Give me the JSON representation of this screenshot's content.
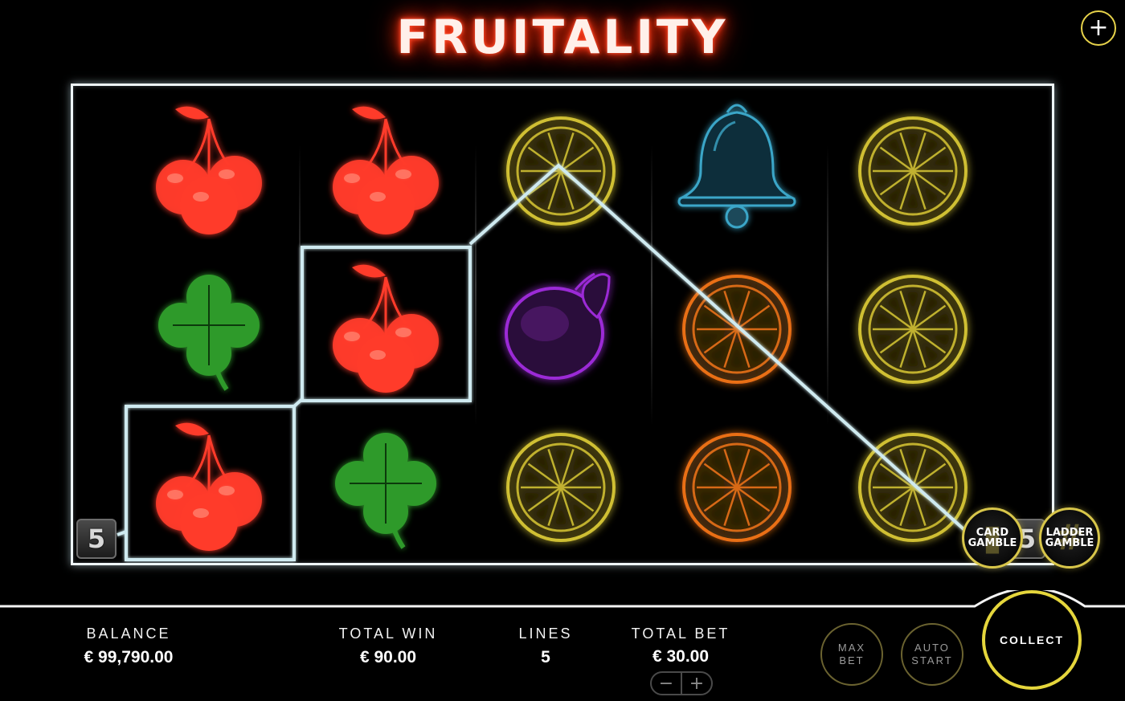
{
  "game": {
    "title": "FRUITALITY"
  },
  "header": {
    "menu_button_label": "+"
  },
  "reels": {
    "columns": [
      [
        "cherries",
        "clover",
        "cherries"
      ],
      [
        "cherries",
        "cherries",
        "clover"
      ],
      [
        "lemon",
        "plum",
        "lemon"
      ],
      [
        "bell",
        "orange",
        "orange"
      ],
      [
        "lemon",
        "lemon",
        "lemon"
      ]
    ],
    "win_line_badge_left": "5",
    "win_line_badge_right": "5",
    "highlighted_symbols": [
      "reel-1-row-3",
      "reel-2-row-2"
    ]
  },
  "gamble": {
    "card": {
      "line1": "CARD",
      "line2": "GAMBLE"
    },
    "ladder": {
      "line1": "LADDER",
      "line2": "GAMBLE"
    }
  },
  "stats": {
    "balance_label": "BALANCE",
    "balance_value": "€ 99,790.00",
    "total_win_label": "TOTAL WIN",
    "total_win_value": "€ 90.00",
    "lines_label": "LINES",
    "lines_value": "5",
    "total_bet_label": "TOTAL BET",
    "total_bet_value": "€ 30.00"
  },
  "controls": {
    "decrease_bet": "−",
    "increase_bet": "+",
    "max_bet": {
      "line1": "MAX",
      "line2": "BET"
    },
    "auto_start": {
      "line1": "AUTO",
      "line2": "START"
    },
    "collect": "COLLECT"
  },
  "colors": {
    "title_glow": "#ff3a1a",
    "frame": "#eef6f8",
    "win_line": "#cfeaf0",
    "accent_gold": "#e5d63c",
    "cherry": "#ff3b2a",
    "clover": "#2f9a2a",
    "lemon": "#e3d23a",
    "orange": "#ff7a1a",
    "plum": "#9b2bd6",
    "bell": "#3aa6c8"
  }
}
